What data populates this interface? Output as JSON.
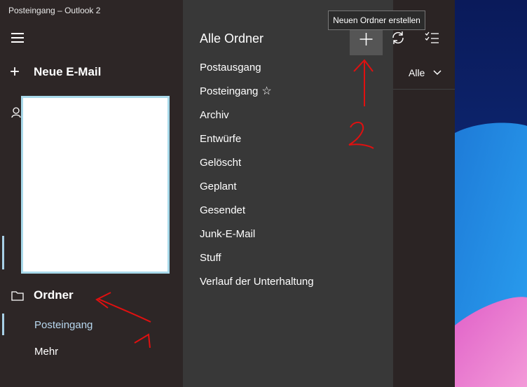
{
  "window": {
    "title": "Posteingang – Outlook 2"
  },
  "left_nav": {
    "menu_icon": "hamburger-icon",
    "new_mail_label": "Neue E-Mail",
    "folder_label": "Ordner",
    "items": [
      {
        "label": "Posteingang"
      },
      {
        "label": "Mehr"
      }
    ]
  },
  "folders_pane": {
    "header": "Alle Ordner",
    "folders": [
      {
        "label": "Postausgang"
      },
      {
        "label": "Posteingang",
        "favorite_icon": "star-icon"
      },
      {
        "label": "Archiv"
      },
      {
        "label": "Entwürfe"
      },
      {
        "label": "Gelöscht"
      },
      {
        "label": "Geplant"
      },
      {
        "label": "Gesendet"
      },
      {
        "label": "Junk-E-Mail"
      },
      {
        "label": "Stuff"
      },
      {
        "label": "Verlauf der Unterhaltung"
      }
    ]
  },
  "toolbar": {
    "tooltip": "Neuen Ordner erstellen",
    "new_folder_icon": "plus-icon",
    "sync_icon": "sync-icon",
    "select_icon": "select-checklist-icon"
  },
  "filter": {
    "label": "Alle"
  },
  "colors": {
    "pane_bg": "#2d2626",
    "folders_bg": "#383838",
    "accent": "#a8d0e6",
    "annotation": "#e01010"
  },
  "annotations": {
    "mark_1": "1",
    "mark_2": "2"
  }
}
